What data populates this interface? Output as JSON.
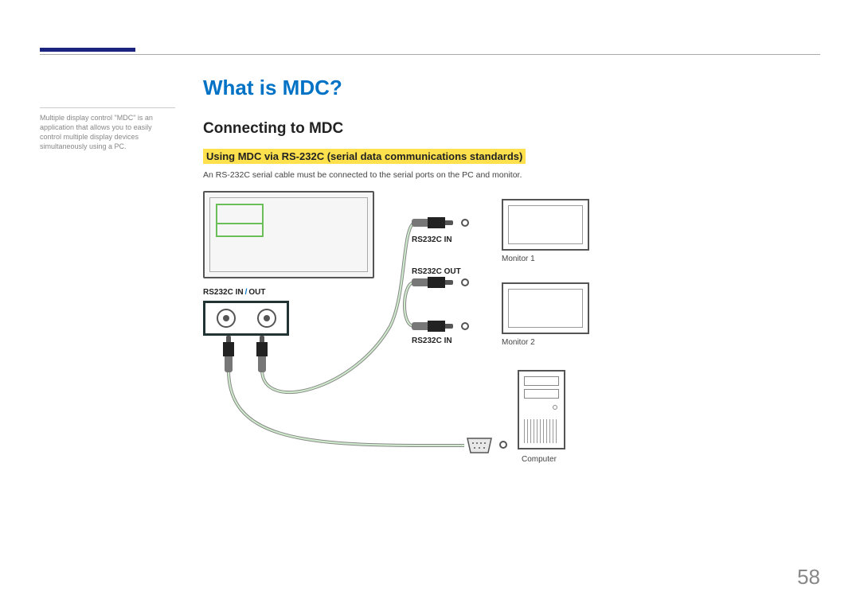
{
  "page": {
    "number": "58"
  },
  "sidenote": {
    "text": "Multiple display control \"MDC\" is an application that allows you to easily control multiple display devices simultaneously using a PC."
  },
  "headings": {
    "title": "What is MDC?",
    "subtitle": "Connecting to MDC",
    "highlight": "Using MDC via RS-232C (serial data communications standards)"
  },
  "body": {
    "p1": "An RS-232C serial cable must be connected to the serial ports on the PC and monitor."
  },
  "diagram": {
    "jack_panel_label_pre": "RS232C IN",
    "jack_panel_label_post": "OUT",
    "slash": "/",
    "plug_top_in": "RS232C IN",
    "plug_mid_out": "RS232C OUT",
    "plug_bot_in": "RS232C IN",
    "monitor1": "Monitor 1",
    "monitor2": "Monitor 2",
    "computer": "Computer"
  }
}
